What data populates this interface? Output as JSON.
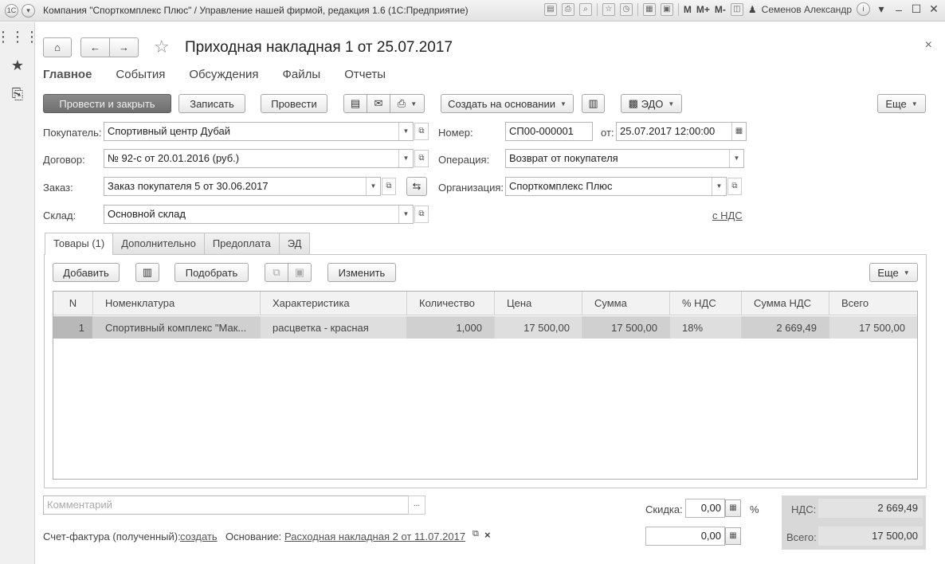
{
  "window": {
    "title": "Компания \"Спорткомплекс Плюс\" / Управление нашей фирмой, редакция 1.6  (1С:Предприятие)",
    "toolbar_text": [
      "M",
      "M+",
      "M-"
    ],
    "user": "Семенов Александр"
  },
  "document": {
    "title": "Приходная накладная 1 от 25.07.2017"
  },
  "nav_tabs": [
    "Главное",
    "События",
    "Обсуждения",
    "Файлы",
    "Отчеты"
  ],
  "toolbar": {
    "post_close": "Провести и закрыть",
    "save": "Записать",
    "post": "Провести",
    "create_based": "Создать на основании",
    "edo": "ЭДО",
    "more": "Еще"
  },
  "form": {
    "buyer_label": "Покупатель:",
    "buyer": "Спортивный центр Дубай",
    "contract_label": "Договор:",
    "contract": "№ 92-с от 20.01.2016 (руб.)",
    "order_label": "Заказ:",
    "order": "Заказ покупателя 5 от 30.06.2017",
    "warehouse_label": "Склад:",
    "warehouse": "Основной склад",
    "number_label": "Номер:",
    "number": "СП00-000001",
    "date_label": "от:",
    "date": "25.07.2017 12:00:00",
    "operation_label": "Операция:",
    "operation": "Возврат от покупателя",
    "org_label": "Организация:",
    "org": "Спорткомплекс Плюс",
    "vat_link": "с НДС"
  },
  "inner_tabs": [
    "Товары (1)",
    "Дополнительно",
    "Предоплата",
    "ЭД"
  ],
  "goods_toolbar": {
    "add": "Добавить",
    "pick": "Подобрать",
    "change": "Изменить",
    "more": "Еще"
  },
  "table": {
    "columns": [
      "N",
      "Номенклатура",
      "Характеристика",
      "Количество",
      "Цена",
      "Сумма",
      "% НДС",
      "Сумма НДС",
      "Всего"
    ],
    "rows": [
      [
        "1",
        "Спортивный комплекс \"Мак...",
        "расцветка - красная",
        "1,000",
        "17 500,00",
        "17 500,00",
        "18%",
        "2 669,49",
        "17 500,00"
      ]
    ]
  },
  "footer": {
    "comment_placeholder": "Комментарий",
    "comment_btn": "...",
    "invoice_label": "Счет-фактура (полученный):",
    "invoice_link": "создать",
    "basis_label": "Основание:",
    "basis_link": "Расходная накладная 2 от 11.07.2017",
    "discount_label": "Скидка:",
    "discount": "0,00",
    "percent": "%",
    "discount_sum": "0,00",
    "vat_label": "НДС:",
    "vat": "2 669,49",
    "total_label": "Всего:",
    "total": "17 500,00"
  }
}
